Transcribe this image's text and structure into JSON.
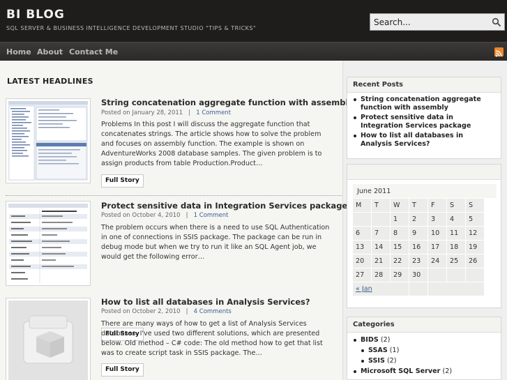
{
  "site": {
    "title": "BI BLOG",
    "description": "SQL SERVER & BUSINESS INTELLIGENCE DEVELOPMENT STUDIO \"TIPS & TRICKS\"",
    "search_placeholder": "Search..."
  },
  "nav": [
    "Home",
    "About",
    "Contact Me"
  ],
  "icons": {
    "rss": "rss-icon",
    "search": "search-icon"
  },
  "colors": {
    "header": "#1f1d1c",
    "nav": "#333130",
    "link": "#3a5f8f",
    "rss": "#f0852b"
  },
  "main": {
    "heading": "LATEST HEADLINES",
    "posts": [
      {
        "title": "String concatenation aggregate function with assembly",
        "date": "Posted on January 28, 2011",
        "comments": "1 Comment",
        "excerpt": "Problems In this post I will discuss the aggregate function that concatenates strings. The article shows how to solve the problem and focuses on assembly function. The example is shown on AdventureWorks 2008 database samples. The given problem is to assign products from table Production.Product…",
        "button": "Full Story"
      },
      {
        "title": "Protect sensitive data in Integration Services package",
        "date": "Posted on October 4, 2010",
        "comments": "1 Comment",
        "excerpt": "The problem occurs when there is a need to use SQL Authentication in one of connections in SSIS package. The package can be run in debug mode but when we try to run it like an SQL Agent job, we would get the following error…",
        "button": "Full Story"
      },
      {
        "title": "How to list all databases in Analysis Services?",
        "date": "Posted on October 2, 2010",
        "comments": "4 Comments",
        "excerpt": "There are many ways of how to get a list of Analysis Services databases. I've used two different solutions, which are presented below. Old method – C# code: The old method how to get that list was to create script task in SSIS package. The…",
        "button": "Full Story"
      }
    ]
  },
  "sidebar": {
    "recent_title": "Recent Posts",
    "recent": [
      "String concatenation aggregate function with assembly",
      "Protect sensitive data in Integration Services package",
      "How to list all databases in Analysis Services?"
    ],
    "calendar": {
      "caption": "June 2011",
      "days": [
        "M",
        "T",
        "W",
        "T",
        "F",
        "S",
        "S"
      ],
      "weeks": [
        [
          "",
          "",
          "1",
          "2",
          "3",
          "4",
          "5"
        ],
        [
          "6",
          "7",
          "8",
          "9",
          "10",
          "11",
          "12"
        ],
        [
          "13",
          "14",
          "15",
          "16",
          "17",
          "18",
          "19"
        ],
        [
          "20",
          "21",
          "22",
          "23",
          "24",
          "25",
          "26"
        ],
        [
          "27",
          "28",
          "29",
          "30",
          "",
          "",
          ""
        ]
      ],
      "prev": "« Jan"
    },
    "categories_title": "Categories",
    "categories": [
      {
        "name": "BIDS",
        "count": "(2)",
        "level": 0
      },
      {
        "name": "SSAS",
        "count": "(1)",
        "level": 1
      },
      {
        "name": "SSIS",
        "count": "(2)",
        "level": 1
      },
      {
        "name": "Microsoft SQL Server",
        "count": "(2)",
        "level": 0
      }
    ]
  }
}
